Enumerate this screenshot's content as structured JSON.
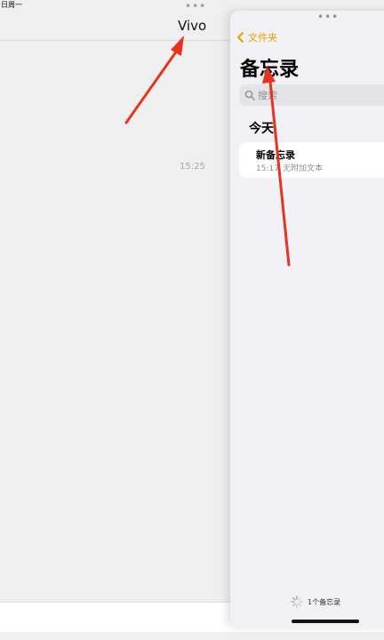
{
  "status_bar": {
    "date": "日周一"
  },
  "left_pane": {
    "title": "Vivo",
    "message_time": "15:25"
  },
  "notes_panel": {
    "back_label": "文件夹",
    "title": "备忘录",
    "search": {
      "placeholder": "搜索"
    },
    "section_header": "今天",
    "notes": [
      {
        "title": "新备忘录",
        "time": "15:17",
        "preview": "无附加文本"
      }
    ],
    "footer_count": "1个备忘录"
  },
  "colors": {
    "accent": "#e6a100",
    "arrow": "#e8321f",
    "panel_bg": "#f1f0f5",
    "background": "#efeff0"
  }
}
